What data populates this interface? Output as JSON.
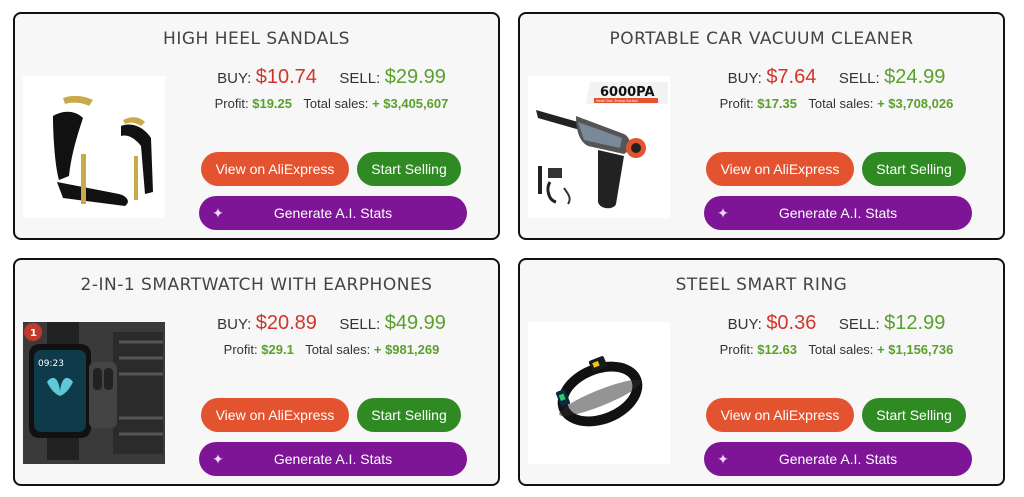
{
  "labels": {
    "buy": "BUY:",
    "sell": "SELL:",
    "profit": "Profit:",
    "total_sales": "Total sales:",
    "view_button": "View on AliExpress",
    "sell_button": "Start Selling",
    "ai_button": "Generate A.I. Stats"
  },
  "colors": {
    "buy_price": "#d0342c",
    "sell_price": "#5aa02c",
    "view_button": "#e4532f",
    "sell_button": "#2f8a23",
    "ai_button": "#7d1596"
  },
  "products": [
    {
      "title": "HIGH HEEL SANDALS",
      "buy_price": "$10.74",
      "sell_price": "$29.99",
      "profit": "$19.25",
      "total_sales": "+ $3,405,607",
      "image": "high-heel-sandal-image"
    },
    {
      "title": "PORTABLE CAR VACUUM CLEANER",
      "buy_price": "$7.64",
      "sell_price": "$24.99",
      "profit": "$17.35",
      "total_sales": "+ $3,708,026",
      "image": "car-vacuum-image",
      "image_text": "6000PA",
      "image_subtext": "Small Size, Strong Suction"
    },
    {
      "title": "2-IN-1 SMARTWATCH WITH EARPHONES",
      "buy_price": "$20.89",
      "sell_price": "$49.99",
      "profit": "$29.1",
      "total_sales": "+ $981,269",
      "image": "smartwatch-image",
      "image_text": "09:23",
      "image_badge": "1"
    },
    {
      "title": "STEEL SMART RING",
      "buy_price": "$0.36",
      "sell_price": "$12.99",
      "profit": "$12.63",
      "total_sales": "+ $1,156,736",
      "image": "smart-ring-image"
    }
  ]
}
